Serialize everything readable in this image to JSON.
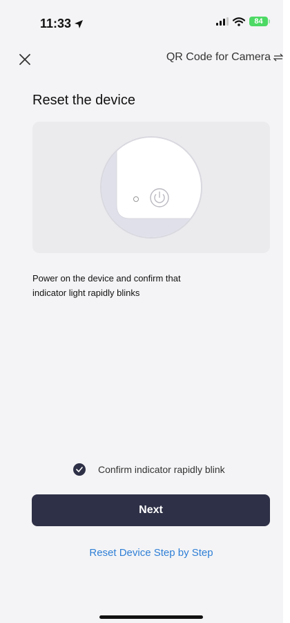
{
  "status_bar": {
    "time": "11:33",
    "battery": "84",
    "battery_color": "#4cd964"
  },
  "nav": {
    "close_icon": "close-icon",
    "switch_label": "QR Code for Camera",
    "switch_icon": "swap-arrows-icon"
  },
  "title": "Reset the device",
  "illustration": {
    "icon": "power-icon",
    "indicator": "indicator-light"
  },
  "instruction": "Power on the device and confirm that indicator light rapidly blinks",
  "confirm": {
    "checked": true,
    "label": "Confirm indicator rapidly blink"
  },
  "next_label": "Next",
  "reset_link": "Reset Device Step by Step",
  "colors": {
    "primary": "#2e3047",
    "link": "#2f7fd6",
    "background": "#f4f4f6"
  }
}
